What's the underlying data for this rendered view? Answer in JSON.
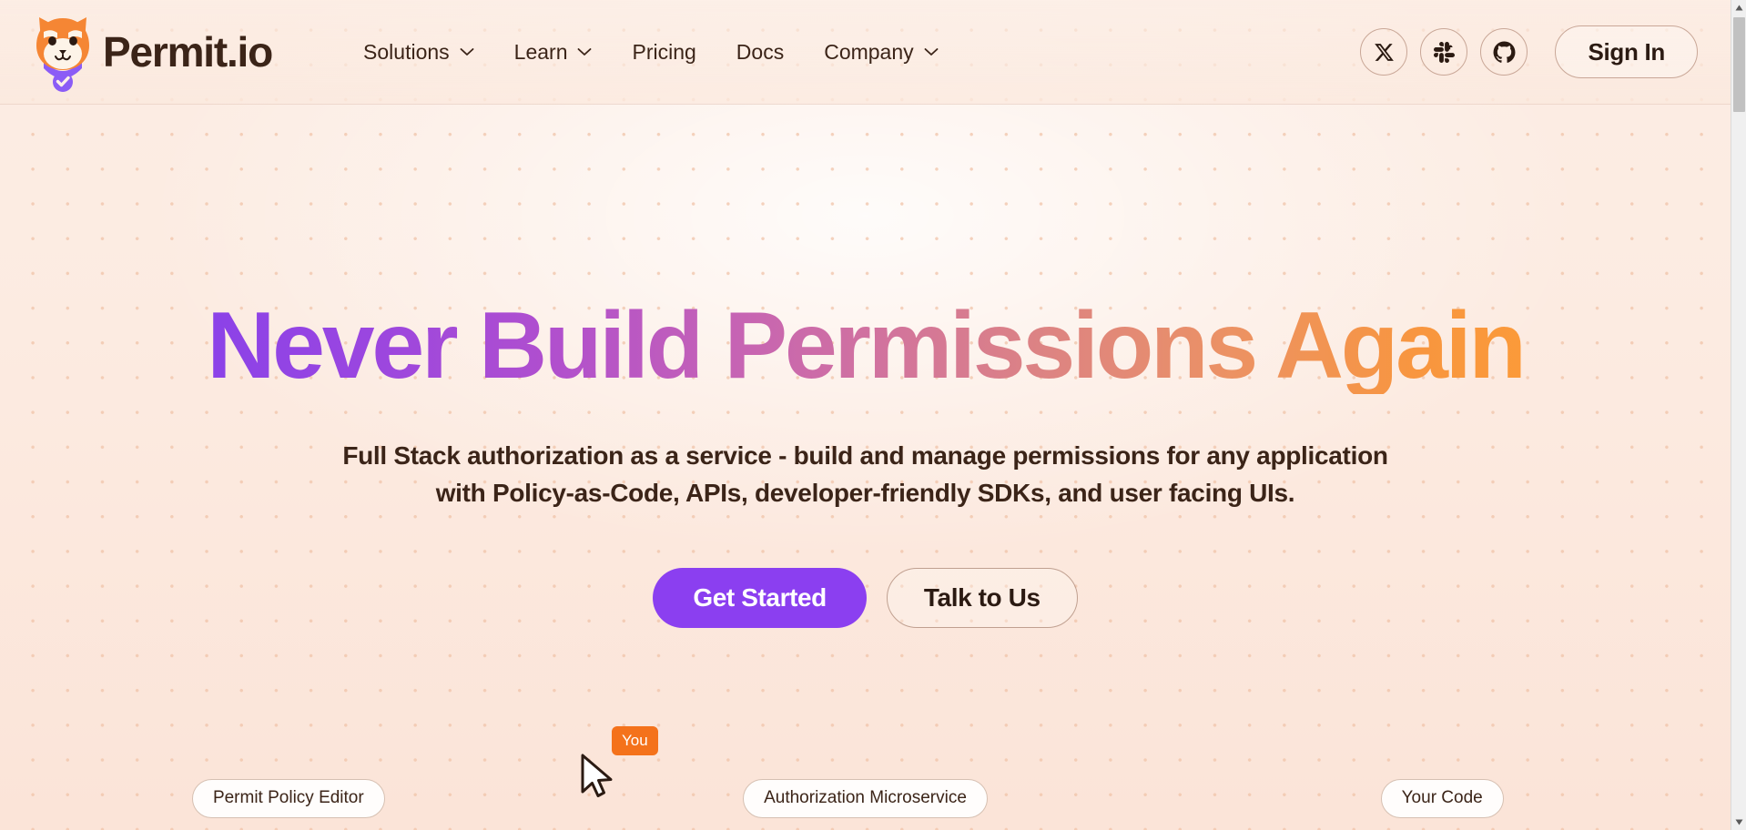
{
  "header": {
    "logo": {
      "icon": "shiba-dog-logo-icon",
      "text": "Permit.io",
      "head_color": "#F58634",
      "muzzle_color": "#FDF4E8",
      "collar_color": "#8B5CF6"
    },
    "nav_items": [
      {
        "label": "Solutions",
        "has_dropdown": true,
        "icon": "chevron-down-icon"
      },
      {
        "label": "Learn",
        "has_dropdown": true,
        "icon": "chevron-down-icon"
      },
      {
        "label": "Pricing",
        "has_dropdown": false,
        "icon": ""
      },
      {
        "label": "Docs",
        "has_dropdown": false,
        "icon": ""
      },
      {
        "label": "Company",
        "has_dropdown": true,
        "icon": "chevron-down-icon"
      }
    ],
    "social_links": [
      {
        "name": "x-twitter-icon",
        "label": "X"
      },
      {
        "name": "slack-icon",
        "label": "Slack"
      },
      {
        "name": "github-icon",
        "label": "GitHub"
      }
    ],
    "sign_in_label": "Sign In"
  },
  "hero": {
    "headline": "Never Build Permissions Again",
    "headline_gradient_from": "#8B42E8",
    "headline_gradient_mid": "#D2749C",
    "headline_gradient_to": "#FB9A3A",
    "subtitle_line1": "Full Stack authorization as a service - build and manage permissions for any application",
    "subtitle_line2": "with Policy-as-Code, APIs, developer-friendly SDKs, and user facing UIs.",
    "primary_cta": "Get Started",
    "primary_cta_color": "#8B3FF0",
    "secondary_cta": "Talk to Us"
  },
  "cursor": {
    "label": "You",
    "badge_color": "#F4721B",
    "icon": "mouse-pointer-icon"
  },
  "flow": {
    "pills": [
      {
        "label": "Permit Policy Editor"
      },
      {
        "label": "Authorization Microservice"
      },
      {
        "label": "Your Code"
      }
    ]
  },
  "scrollbar": {
    "up_arrow": "▲",
    "down_arrow": "▼"
  },
  "theme": {
    "background": "#FCEDE4",
    "dot_color": "#F0C3A8",
    "text_color": "#3B2418",
    "border_color": "#C9A797"
  }
}
